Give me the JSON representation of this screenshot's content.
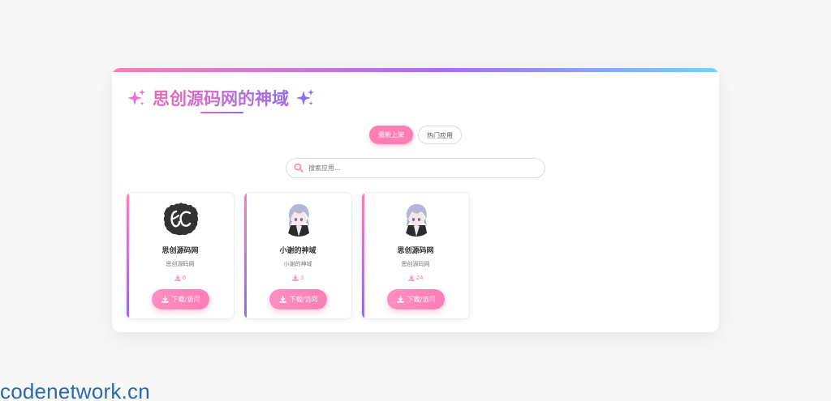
{
  "header": {
    "title": "思创源码网的神域"
  },
  "tabs": [
    {
      "label": "最新上架",
      "active": true
    },
    {
      "label": "热门应用",
      "active": false
    }
  ],
  "search": {
    "placeholder": "搜索应用..."
  },
  "cards": [
    {
      "name": "思创源码网",
      "desc": "思创源码网",
      "downloads": "6",
      "button": "下载/访问",
      "avatar": "sc-logo"
    },
    {
      "name": "小谢的神域",
      "desc": "小谢的神域",
      "downloads": "3",
      "button": "下载/访问",
      "avatar": "anime-character"
    },
    {
      "name": "思创源码网",
      "desc": "思创源码网",
      "downloads": "24",
      "button": "下载/访问",
      "avatar": "anime-character"
    }
  ],
  "watermark": "codenetwork.cn",
  "colors": {
    "accent_pink": "#ff7eb3",
    "accent_purple": "#9a6cf0",
    "accent_blue": "#6fd3ff",
    "watermark_blue": "#2a6aa8"
  },
  "icons": {
    "title_left": "sparkles-icon",
    "title_right": "sparkles-icon",
    "search": "search-icon",
    "download": "download-icon"
  }
}
